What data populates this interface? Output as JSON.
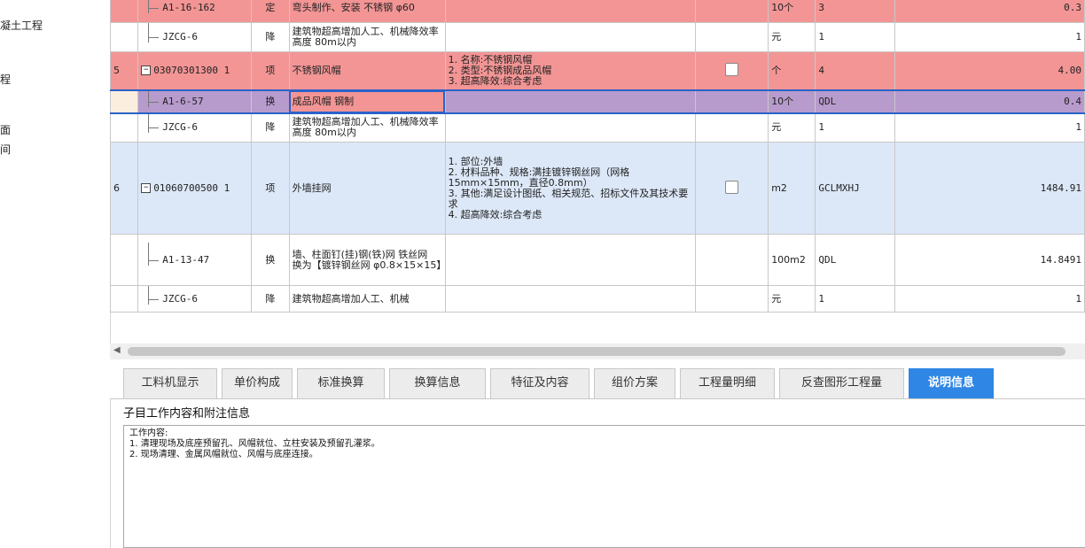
{
  "sidebar": {
    "items": [
      "凝土工程",
      "程",
      "面",
      "间"
    ]
  },
  "rows": [
    {
      "style": "pinkw",
      "idx": "",
      "code": "A1-16-162",
      "cat": "定",
      "name": "弯头制作、安装 不锈钢 φ60",
      "feat": "",
      "chk": false,
      "unit": "10个",
      "qty": "3",
      "val": "0.3",
      "child": true
    },
    {
      "style": "white",
      "idx": "",
      "code": "JZCG-6",
      "cat": "降",
      "name": "建筑物超高增加人工、机械降效率 高度 80m以内",
      "feat": "",
      "chk": false,
      "unit": "元",
      "qty": "1",
      "val": "1",
      "child": true
    },
    {
      "style": "pink",
      "idx": "5",
      "code": "03070301300 1",
      "cat": "项",
      "name": "不锈钢风帽",
      "feat": "1. 名称:不锈钢风帽\n2. 类型:不锈钢成品风帽\n3. 超高降效:综合考虑",
      "chk": true,
      "unit": "个",
      "qty": "4",
      "val": "4.00",
      "child": false
    },
    {
      "style": "sel",
      "idx": "",
      "code": "A1-6-57",
      "cat": "换",
      "name": "成品风帽 钢制",
      "feat": "",
      "chk": false,
      "unit": "10个",
      "qty": "QDL",
      "val": "0.4",
      "child": true
    },
    {
      "style": "white",
      "idx": "",
      "code": "JZCG-6",
      "cat": "降",
      "name": "建筑物超高增加人工、机械降效率 高度 80m以内",
      "feat": "",
      "chk": false,
      "unit": "元",
      "qty": "1",
      "val": "1",
      "child": true
    },
    {
      "style": "blue",
      "idx": "6",
      "code": "01060700500 1",
      "cat": "项",
      "name": "外墙挂网",
      "feat": "1. 部位:外墙\n2. 材料品种、规格:满挂镀锌钢丝网（网格15mm×15mm，直径0.8mm）\n3. 其他:满足设计图纸、相关规范、招标文件及其技术要求\n4. 超高降效:综合考虑",
      "chk": true,
      "unit": "m2",
      "qty": "GCLMXHJ",
      "val": "1484.91",
      "child": false
    },
    {
      "style": "white",
      "idx": "",
      "code": "A1-13-47",
      "cat": "换",
      "name": "墙、柱面钉(挂)钢(铁)网 铁丝网　换为【镀锌钢丝网 φ0.8×15×15】",
      "feat": "",
      "chk": false,
      "unit": "100m2",
      "qty": "QDL",
      "val": "14.8491",
      "child": true
    },
    {
      "style": "white",
      "idx": "",
      "code": "JZCG-6",
      "cat": "降",
      "name": "建筑物超高增加人工、机械",
      "feat": "",
      "chk": false,
      "unit": "元",
      "qty": "1",
      "val": "1",
      "child": true
    }
  ],
  "tabs": [
    "工料机显示",
    "单价构成",
    "标准换算",
    "换算信息",
    "特征及内容",
    "组价方案",
    "工程量明细",
    "反查图形工程量",
    "说明信息"
  ],
  "active_tab": "说明信息",
  "panel": {
    "title": "子目工作内容和附注信息",
    "lines": [
      "工作内容:",
      "1. 清理现场及底座预留孔、风帽就位、立柱安装及预留孔灌浆。",
      "2. 现场清理、金属风帽就位、风帽与底座连接。"
    ]
  },
  "colors": {
    "pink": "#f39595",
    "selected": "#b89bcd",
    "blue_row": "#dce8f8",
    "active_tab": "#2f86e5",
    "selection_border": "#2a62c9"
  }
}
